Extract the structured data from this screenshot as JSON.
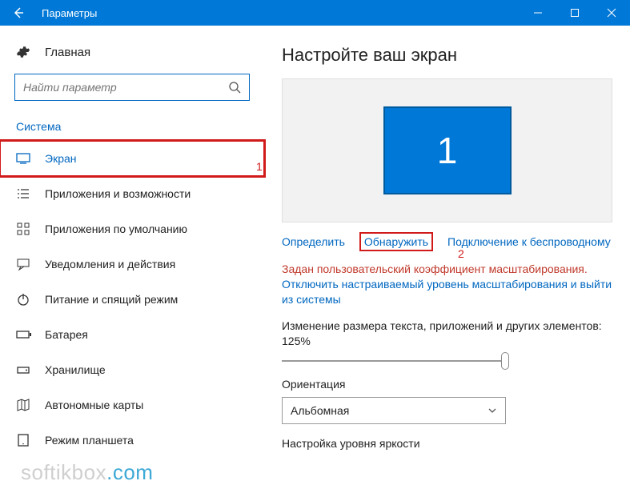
{
  "titlebar": {
    "title": "Параметры"
  },
  "sidebar": {
    "home": "Главная",
    "search_placeholder": "Найти параметр",
    "section_label": "Система",
    "items": [
      {
        "label": "Экран"
      },
      {
        "label": "Приложения и возможности"
      },
      {
        "label": "Приложения по умолчанию"
      },
      {
        "label": "Уведомления и действия"
      },
      {
        "label": "Питание и спящий режим"
      },
      {
        "label": "Батарея"
      },
      {
        "label": "Хранилище"
      },
      {
        "label": "Автономные карты"
      },
      {
        "label": "Режим планшета"
      }
    ]
  },
  "main": {
    "heading": "Настройте ваш экран",
    "monitor_number": "1",
    "links": {
      "identify": "Определить",
      "detect": "Обнаружить",
      "wireless": "Подключение к беспроводному"
    },
    "warning_red": "Задан пользовательский коэффициент масштабирования.",
    "warning_blue": "Отключить настраиваемый уровень масштабирования и выйти из системы",
    "scale_label": "Изменение размера текста, приложений и других элементов: 125%",
    "orientation_label": "Ориентация",
    "orientation_value": "Альбомная",
    "brightness_label": "Настройка уровня яркости"
  },
  "annotations": {
    "a1": "1",
    "a2": "2"
  },
  "watermark": {
    "part1": "softikbox",
    "part2": ".com"
  }
}
